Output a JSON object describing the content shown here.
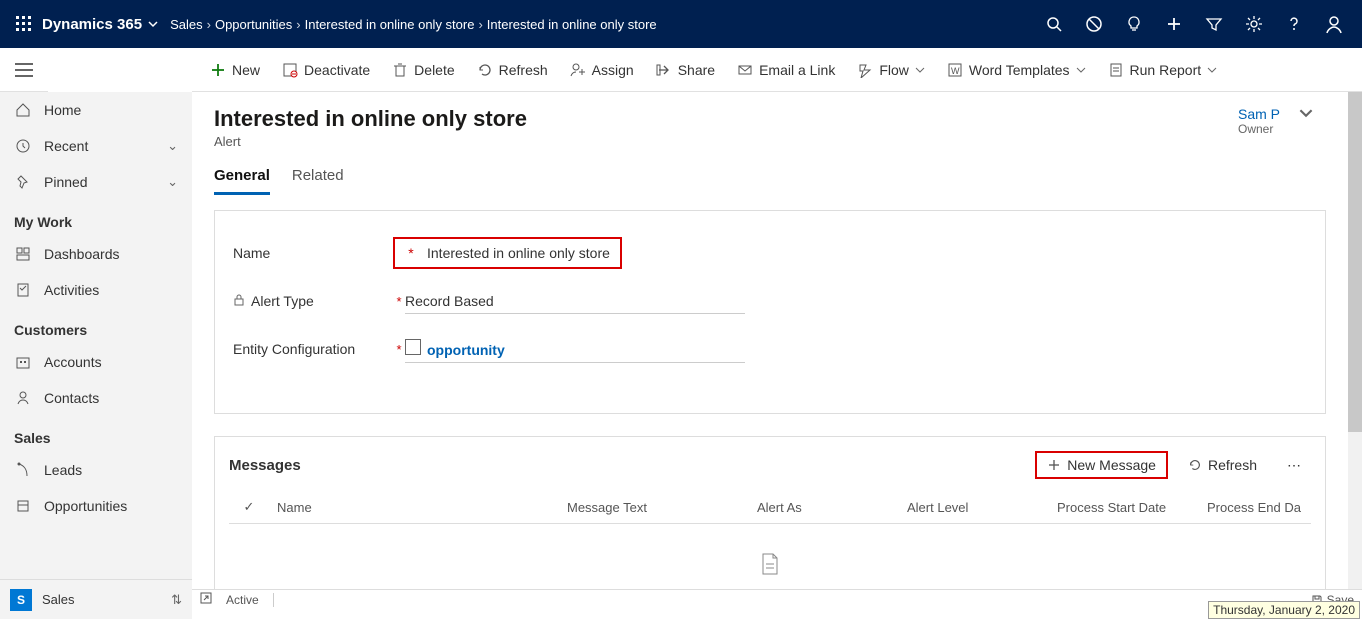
{
  "topbar": {
    "brand": "Dynamics 365",
    "breadcrumbs": [
      "Sales",
      "Opportunities",
      "Interested in online only store",
      "Interested in online only store"
    ]
  },
  "commands": {
    "new": "New",
    "deactivate": "Deactivate",
    "delete": "Delete",
    "refresh": "Refresh",
    "assign": "Assign",
    "share": "Share",
    "email": "Email a Link",
    "flow": "Flow",
    "wordtpl": "Word Templates",
    "runreport": "Run Report"
  },
  "sidebar": {
    "home": "Home",
    "recent": "Recent",
    "pinned": "Pinned",
    "group_mywork": "My Work",
    "dashboards": "Dashboards",
    "activities": "Activities",
    "group_customers": "Customers",
    "accounts": "Accounts",
    "contacts": "Contacts",
    "group_sales": "Sales",
    "leads": "Leads",
    "opportunities": "Opportunities",
    "area_letter": "S",
    "area_label": "Sales"
  },
  "page": {
    "title": "Interested in online only store",
    "subtitle": "Alert",
    "owner_name": "Sam P",
    "owner_label": "Owner",
    "tabs": {
      "general": "General",
      "related": "Related"
    }
  },
  "form": {
    "name_label": "Name",
    "name_value": "Interested in online only store",
    "alerttype_label": "Alert Type",
    "alerttype_value": "Record Based",
    "entitycfg_label": "Entity Configuration",
    "entitycfg_value": "opportunity"
  },
  "messages": {
    "title": "Messages",
    "new_btn": "New Message",
    "refresh_btn": "Refresh",
    "cols": {
      "name": "Name",
      "text": "Message Text",
      "as": "Alert As",
      "level": "Alert Level",
      "start": "Process Start Date",
      "end": "Process End Da"
    }
  },
  "status": {
    "active": "Active",
    "save": "Save"
  },
  "tooltip": "Thursday, January 2, 2020"
}
